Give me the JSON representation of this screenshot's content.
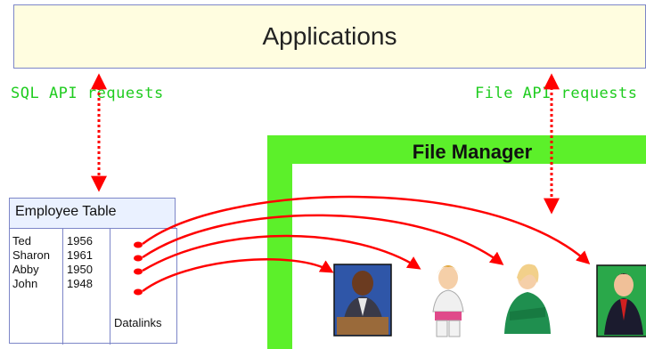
{
  "applications_label": "Applications",
  "sql_api_label": "SQL API requests",
  "file_api_label": "File API requests",
  "file_manager_label": "File Manager",
  "employee_table": {
    "title": "Employee Table",
    "rows": [
      {
        "name": "Ted",
        "year": "1956"
      },
      {
        "name": "Sharon",
        "year": "1961"
      },
      {
        "name": "Abby",
        "year": "1950"
      },
      {
        "name": "John",
        "year": "1948"
      }
    ],
    "datalinks_label": "Datalinks"
  },
  "colors": {
    "file_manager_frame": "#5cf02a",
    "api_text": "#1fcc1f",
    "links": "#ff0000",
    "applications_bg": "#fffde0"
  }
}
